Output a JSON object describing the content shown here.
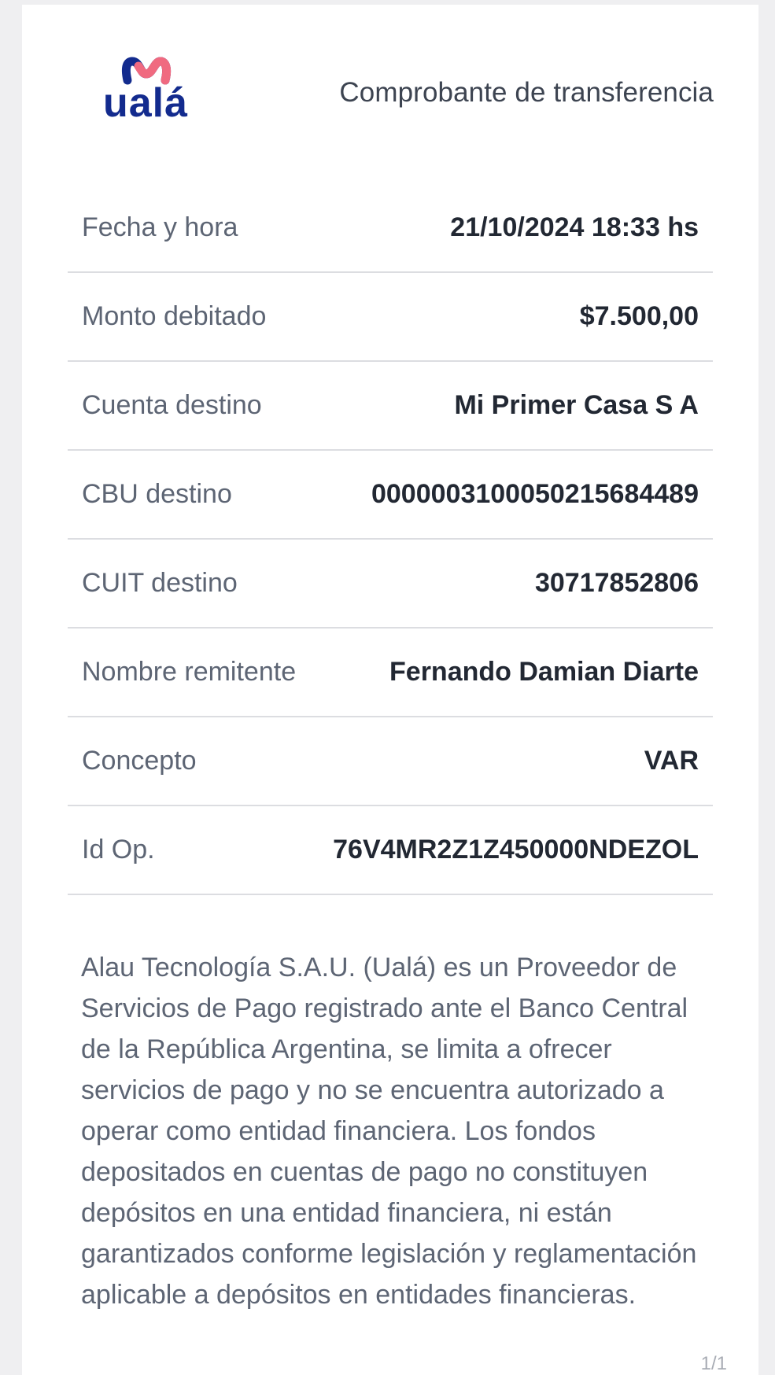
{
  "header": {
    "brand": "ualá",
    "title": "Comprobante de transferencia"
  },
  "rows": [
    {
      "label": "Fecha y hora",
      "value": "21/10/2024 18:33 hs"
    },
    {
      "label": "Monto debitado",
      "value": "$7.500,00"
    },
    {
      "label": "Cuenta destino",
      "value": "Mi Primer Casa S A"
    },
    {
      "label": "CBU destino",
      "value": "0000003100050215684489"
    },
    {
      "label": "CUIT destino",
      "value": "30717852806"
    },
    {
      "label": "Nombre remitente",
      "value": "Fernando Damian Diarte"
    },
    {
      "label": "Concepto",
      "value": "VAR"
    },
    {
      "label": "Id Op.",
      "value": "76V4MR2Z1Z450000NDEZOL"
    }
  ],
  "disclaimer": "Alau Tecnología S.A.U. (Ualá) es un Proveedor de Servicios de Pago registrado ante el Banco Central de la República Argentina, se limita a ofrecer servicios de pago y no se encuentra autorizado a operar como entidad financiera. Los fondos depositados en cuentas de pago no constituyen depósitos en una entidad financiera, ni están garantizados conforme legislación y reglamentación aplicable a depósitos en entidades financieras.",
  "page_indicator": "1/1",
  "colors": {
    "brand_navy": "#132b8e",
    "brand_pink": "#f06a80"
  }
}
